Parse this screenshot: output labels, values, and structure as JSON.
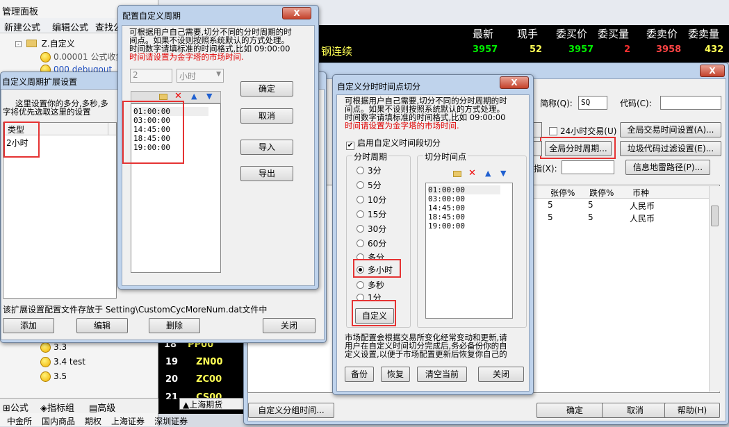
{
  "left_panel": {
    "title": "管理面板",
    "toolbar": [
      "新建公式",
      "编辑公式",
      "查找公"
    ],
    "tree_folder": "Z.自定义",
    "tree_items": [
      "0.00001 公式收集",
      "000 debugout"
    ],
    "lower_items": [
      "3.3",
      "3.4 test",
      "3.5"
    ],
    "bottom_tabs": [
      "公式",
      "指标组",
      "高级"
    ],
    "market_tabs": [
      "中金所",
      "国内商品",
      "期权",
      "上海证券",
      "深圳证券"
    ]
  },
  "quote_header": {
    "columns": [
      "最新",
      "现手",
      "委买价",
      "委买量",
      "委卖价",
      "委卖量"
    ],
    "name": "钢连续",
    "values": [
      "3957",
      "52",
      "3957",
      "2",
      "3958",
      "432"
    ]
  },
  "quote_rows": [
    {
      "num": "18",
      "code": "PP00"
    },
    {
      "num": "19",
      "code": "ZN00"
    },
    {
      "num": "20",
      "code": "ZC00"
    },
    {
      "num": "21",
      "code": "CS00"
    }
  ],
  "exchange_tab": "上海期货",
  "ext_dialog": {
    "title": "自定义周期扩展设置",
    "desc_line1": "这里设置你的多分,多秒,多",
    "desc_line2": "字将优先选取这里的设置",
    "list_header": "类型",
    "list_items": [
      "2小时"
    ],
    "footer_note": "该扩展设置配置文件存放于 Setting\\CustomCycMoreNum.dat文件中",
    "buttons": [
      "添加",
      "编辑",
      "删除",
      "关闭"
    ]
  },
  "cycle_dialog": {
    "title": "配置自定义周期",
    "desc_line1": "可根据用户自己需要,切分不同的分时周期的时",
    "desc_line2": "间点。如果不设则按照系统默认的方式处理。",
    "desc_line3": "时间数字请填标准的时间格式,比如 09:00:00",
    "warning": "时间请设置为金字塔的市场时间.",
    "spin_value": "2",
    "unit_value": "小时",
    "times": [
      "01:00:00",
      "03:00:00",
      "14:45:00",
      "18:45:00",
      "19:00:00"
    ],
    "buttons": [
      "确定",
      "取消",
      "导入",
      "导出"
    ],
    "close": "X"
  },
  "split_dialog": {
    "title": "自定义分时时间点切分",
    "desc_line1": "可根据用户自己需要,切分不同的分时周期的时",
    "desc_line2": "间点。如果不设则按照系统默认的方式处理。",
    "desc_line3": "时间数字请填标准的时间格式,比如 09:00:00",
    "warning": "时间请设置为金字塔的市场时间.",
    "enable_label": "启用自定义时间段切分",
    "period_group": "分时周期",
    "periods": [
      "3分",
      "5分",
      "10分",
      "15分",
      "30分",
      "60分",
      "多分",
      "多小时",
      "多秒",
      "1分"
    ],
    "selected_period": "多小时",
    "custom_button": "自定义",
    "split_group": "切分时间点",
    "times": [
      "01:00:00",
      "03:00:00",
      "14:45:00",
      "18:45:00",
      "19:00:00"
    ],
    "footer_line1": "市场配置会根据交易所变化经常变动和更新,请",
    "footer_line2": "用户在自定义时间切分完成后,务必备份你的自",
    "footer_line3": "定义设置,以便于市场配置更新后恢复你自己的",
    "buttons": [
      "备份",
      "恢复",
      "清空当前",
      "关闭"
    ],
    "close": "X"
  },
  "market_dialog": {
    "short_name_label": "简称(Q):",
    "short_name_value": "SQ",
    "code_label": "代码(C):",
    "code_value": "",
    "h24_label": "24小时交易(U)",
    "global_time_btn": "全局交易时间设置(A)...",
    "global_cycle_btn": "全局分时周期...",
    "filter_btn": "垃圾代码过滤设置(E)...",
    "index_label": "指(X):",
    "info_path_btn": "信息地雷路径(P)...",
    "table_headers": [
      "张停%",
      "跌停%",
      "币种"
    ],
    "table_rows": [
      [
        "5",
        "5",
        "人民币"
      ],
      [
        "5",
        "5",
        "人民币"
      ]
    ],
    "custom_group_btn": "自定义分组时间...",
    "ok": "确定",
    "cancel": "取消",
    "help": "帮助(H)",
    "close": "X"
  }
}
